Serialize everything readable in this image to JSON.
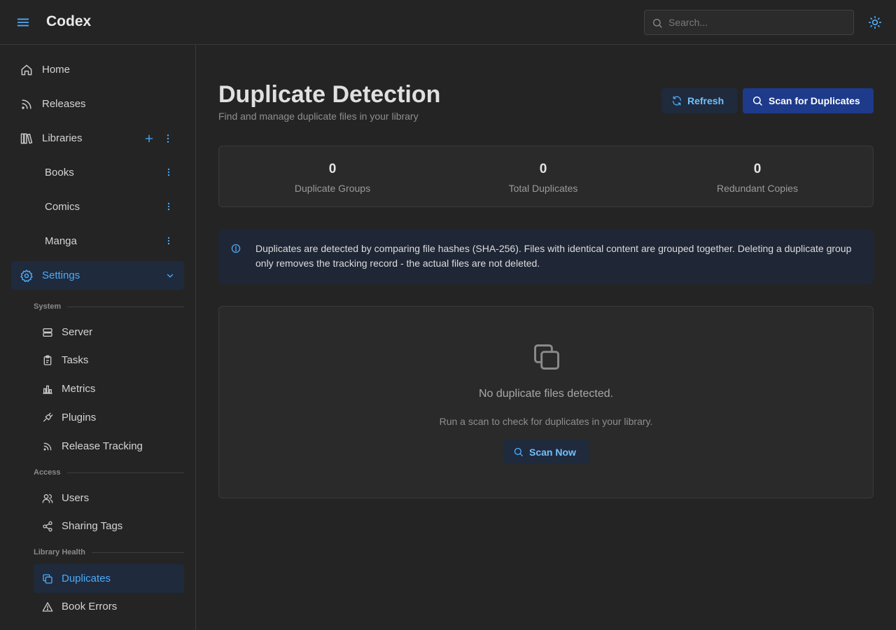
{
  "app": {
    "title": "Codex"
  },
  "header": {
    "search": {
      "placeholder": "Search..."
    }
  },
  "sidebar": {
    "items": [
      {
        "label": "Home",
        "icon": "home-icon"
      },
      {
        "label": "Releases",
        "icon": "rss-icon"
      },
      {
        "label": "Libraries",
        "icon": "books-icon"
      }
    ],
    "libraries": [
      {
        "label": "Books"
      },
      {
        "label": "Comics"
      },
      {
        "label": "Manga"
      }
    ],
    "settings": {
      "label": "Settings",
      "icon": "gear-icon",
      "expanded": true
    },
    "sections": {
      "system": "System",
      "access": "Access",
      "health": "Library Health"
    },
    "settings_items": {
      "server": "Server",
      "tasks": "Tasks",
      "metrics": "Metrics",
      "plugins": "Plugins",
      "release_tracking": "Release Tracking",
      "users": "Users",
      "sharing_tags": "Sharing Tags",
      "duplicates": "Duplicates",
      "book_errors": "Book Errors"
    }
  },
  "main": {
    "title": "Duplicate Detection",
    "subtitle": "Find and manage duplicate files in your library",
    "actions": {
      "refresh": "Refresh",
      "scan": "Scan for Duplicates"
    },
    "stats": [
      {
        "value": "0",
        "label": "Duplicate Groups"
      },
      {
        "value": "0",
        "label": "Total Duplicates"
      },
      {
        "value": "0",
        "label": "Redundant Copies"
      }
    ],
    "info": "Duplicates are detected by comparing file hashes (SHA-256). Files with identical content are grouped together. Deleting a duplicate group only removes the tracking record - the actual files are not deleted.",
    "empty": {
      "message": "No duplicate files detected.",
      "hint": "Run a scan to check for duplicates in your library.",
      "button": "Scan Now"
    }
  },
  "colors": {
    "accent": "#4dabf7",
    "primary_button": "#1e3a8a",
    "active_bg": "#1f2a3d",
    "background": "#242424"
  }
}
